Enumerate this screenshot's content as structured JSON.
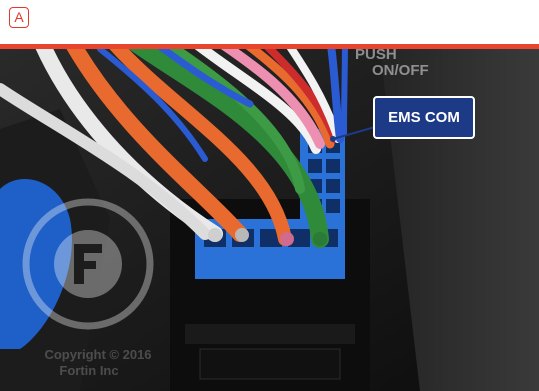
{
  "header": {
    "badge_letter": "A",
    "accent_color": "#e8452f"
  },
  "photo": {
    "subject": "vehicle connector wiring harness",
    "callout": {
      "label": "EMS COM",
      "background_color": "#1d3a87"
    },
    "watermark": {
      "line1": "Copyright © 2016",
      "line2": "Fortin Inc",
      "icon": "fortin-logo-icon"
    },
    "panel_text": {
      "line1": "PUSH",
      "line2": "ON/OFF"
    },
    "wire_colors": [
      "#f2f2f2",
      "#e86a2e",
      "#2f8a3a",
      "#ec8fb1",
      "#2a5bd3",
      "#cc2c2c"
    ],
    "connector_color": "#2a72d8"
  }
}
